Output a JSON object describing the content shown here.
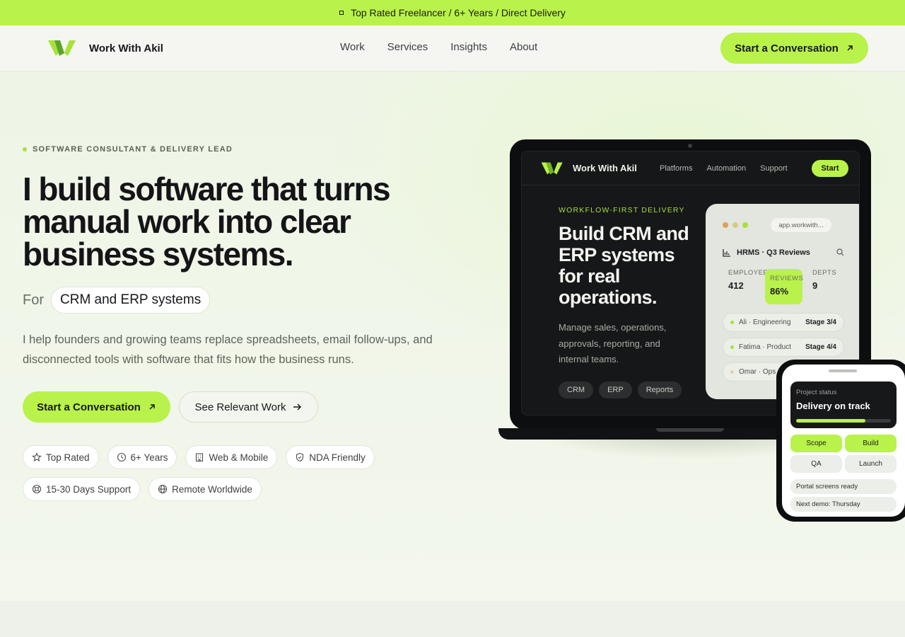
{
  "announcement": {
    "text": "Top Rated Freelancer / 6+ Years / Direct Delivery"
  },
  "header": {
    "brand": "Work With Akil",
    "nav": [
      "Work",
      "Services",
      "Insights",
      "About"
    ],
    "cta": "Start a Conversation"
  },
  "hero": {
    "eyebrow": "SOFTWARE CONSULTANT & DELIVERY LEAD",
    "headline": "I build software that turns manual work into clear business systems.",
    "for_label": "For",
    "for_value": "CRM and ERP systems",
    "description": "I help founders and growing teams replace spreadsheets, email follow-ups, and disconnected tools with software that fits how the business runs.",
    "primary_cta": "Start a Conversation",
    "secondary_cta": "See Relevant Work",
    "chips": [
      {
        "label": "Top Rated",
        "icon": "star-icon"
      },
      {
        "label": "6+ Years",
        "icon": "clock-icon"
      },
      {
        "label": "Web & Mobile",
        "icon": "building-icon"
      },
      {
        "label": "NDA Friendly",
        "icon": "shield-icon"
      },
      {
        "label": "15-30 Days Support",
        "icon": "lifebuoy-icon"
      },
      {
        "label": "Remote Worldwide",
        "icon": "globe-icon"
      }
    ]
  },
  "laptop": {
    "brand": "Work With Akil",
    "links": [
      "Platforms",
      "Automation",
      "Support"
    ],
    "start": "Start",
    "eyebrow": "WORKFLOW-FIRST DELIVERY",
    "title": "Build CRM and ERP systems for real operations.",
    "description": "Manage sales, operations, approvals, reporting, and internal teams.",
    "tags": [
      "CRM",
      "ERP",
      "Reports"
    ],
    "dashboard": {
      "url": "app.workwith...",
      "title": "HRMS · Q3 Reviews",
      "stats": [
        {
          "label": "EMPLOYEES",
          "value": "412"
        },
        {
          "label": "REVIEWS",
          "value": "86%"
        },
        {
          "label": "DEPTS",
          "value": "9"
        }
      ],
      "rows": [
        {
          "name": "Ali · Engineering",
          "stage": "Stage 3/4"
        },
        {
          "name": "Fatima · Product",
          "stage": "Stage 4/4"
        },
        {
          "name": "Omar · Ops",
          "stage": ""
        }
      ],
      "dot_colors": [
        "#e0a05a",
        "#d9c98a",
        "#a6e23a"
      ]
    }
  },
  "phone": {
    "status_label": "Project status",
    "status_value": "Delivery on track",
    "progress": 0.73,
    "buttons": [
      "Scope",
      "Build",
      "QA",
      "Launch"
    ],
    "notes": [
      "Portal screens ready",
      "Next demo: Thursday"
    ]
  },
  "colors": {
    "accent": "#b9f24a",
    "dark": "#0d0e0f"
  }
}
